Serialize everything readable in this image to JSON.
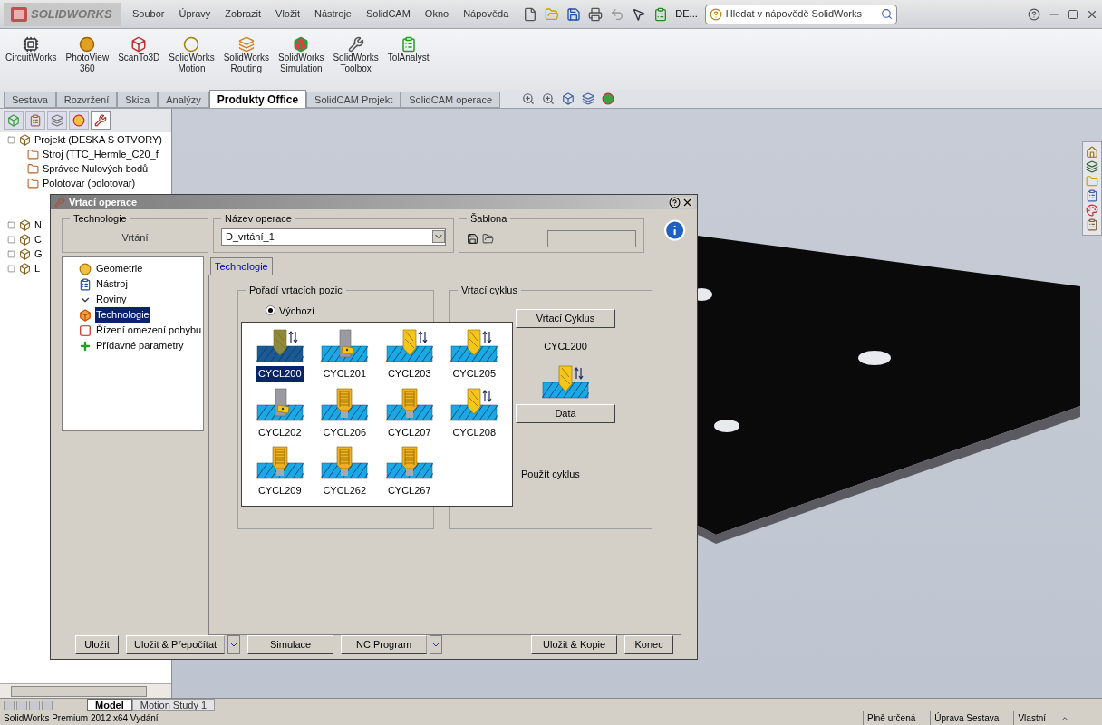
{
  "menu_bar": {
    "logo": "SOLIDWORKS",
    "menus": [
      "Soubor",
      "Úpravy",
      "Zobrazit",
      "Vložit",
      "Nástroje",
      "SolidCAM",
      "Okno",
      "Nápověda"
    ],
    "document_name": "DE...",
    "search": {
      "placeholder": "Hledat v nápovědě SolidWorks"
    }
  },
  "ribbon": {
    "commands": [
      {
        "label": "CircuitWorks"
      },
      {
        "label": "PhotoView\n360"
      },
      {
        "label": "ScanTo3D"
      },
      {
        "label": "SolidWorks\nMotion"
      },
      {
        "label": "SolidWorks\nRouting"
      },
      {
        "label": "SolidWorks\nSimulation"
      },
      {
        "label": "SolidWorks\nToolbox"
      },
      {
        "label": "TolAnalyst"
      }
    ]
  },
  "command_tabs": [
    {
      "label": "Sestava",
      "selected": false
    },
    {
      "label": "Rozvržení",
      "selected": false
    },
    {
      "label": "Skica",
      "selected": false
    },
    {
      "label": "Analýzy",
      "selected": false
    },
    {
      "label": "Produkty Office",
      "selected": true
    },
    {
      "label": "SolidCAM Projekt",
      "selected": false
    },
    {
      "label": "SolidCAM operace",
      "selected": false
    }
  ],
  "feature_tree": {
    "items": [
      {
        "label": "Projekt (DESKA S OTVORY)",
        "children": [
          {
            "label": "Stroj (TTC_Hermle_C20_f"
          },
          {
            "label": "Správce Nulových bodů"
          },
          {
            "label": "Polotovar (polotovar)"
          }
        ]
      },
      {
        "label": "N"
      },
      {
        "label": "C"
      },
      {
        "label": "G"
      },
      {
        "label": "L"
      }
    ]
  },
  "dialog": {
    "title": "Vrtací operace",
    "technology": {
      "legend": "Technologie",
      "value": "Vrtání"
    },
    "operation_name": {
      "legend": "Název operace",
      "value": "D_vrtání_1"
    },
    "template": {
      "legend": "Šablona"
    },
    "nav_tree": [
      {
        "label": "Geometrie",
        "selected": false
      },
      {
        "label": "Nástroj",
        "selected": false
      },
      {
        "label": "Roviny",
        "selected": false
      },
      {
        "label": "Technologie",
        "selected": true
      },
      {
        "label": "Řízení omezení pohybu",
        "selected": false
      },
      {
        "label": "Přídavné parametry",
        "selected": false
      }
    ],
    "tabs": [
      {
        "label": "Technologie",
        "selected": true
      }
    ],
    "position_order": {
      "legend": "Pořadí vrtacích pozic",
      "options": [
        {
          "label": "Výchozí",
          "selected": true
        }
      ]
    },
    "cycle": {
      "legend": "Vrtací cyklus",
      "button": "Vrtací Cyklus",
      "current": "CYCL200",
      "data_button": "Data",
      "use_label": "Použít cyklus"
    },
    "cycle_picker": [
      {
        "label": "CYCL200",
        "kind": "drill",
        "selected": true
      },
      {
        "label": "CYCL201",
        "kind": "boring",
        "selected": false
      },
      {
        "label": "CYCL203",
        "kind": "drill",
        "selected": false
      },
      {
        "label": "CYCL205",
        "kind": "drill",
        "selected": false
      },
      {
        "label": "CYCL202",
        "kind": "boring",
        "selected": false
      },
      {
        "label": "CYCL206",
        "kind": "tap",
        "selected": false
      },
      {
        "label": "CYCL207",
        "kind": "tap",
        "selected": false
      },
      {
        "label": "CYCL208",
        "kind": "drill",
        "selected": false
      },
      {
        "label": "CYCL209",
        "kind": "tap",
        "selected": false
      },
      {
        "label": "CYCL262",
        "kind": "tap",
        "selected": false
      },
      {
        "label": "CYCL267",
        "kind": "tap",
        "selected": false
      }
    ],
    "buttons": [
      {
        "label": "Uložit",
        "dropdown": false
      },
      {
        "label": "Uložit & Přepočítat",
        "dropdown": true
      },
      {
        "label": "Simulace",
        "dropdown": false
      },
      {
        "label": "NC Program",
        "dropdown": true
      },
      {
        "label": "Uložit & Kopie",
        "dropdown": false
      },
      {
        "label": "Konec",
        "dropdown": false
      }
    ]
  },
  "bottom_tabs": [
    {
      "label": "Model",
      "selected": true
    },
    {
      "label": "Motion Study 1",
      "selected": false
    }
  ],
  "status_bar": {
    "text": "SolidWorks Premium 2012 x64 Vydání",
    "panes": [
      "Plně určená",
      "Úprava Sestava",
      "Vlastní"
    ]
  }
}
